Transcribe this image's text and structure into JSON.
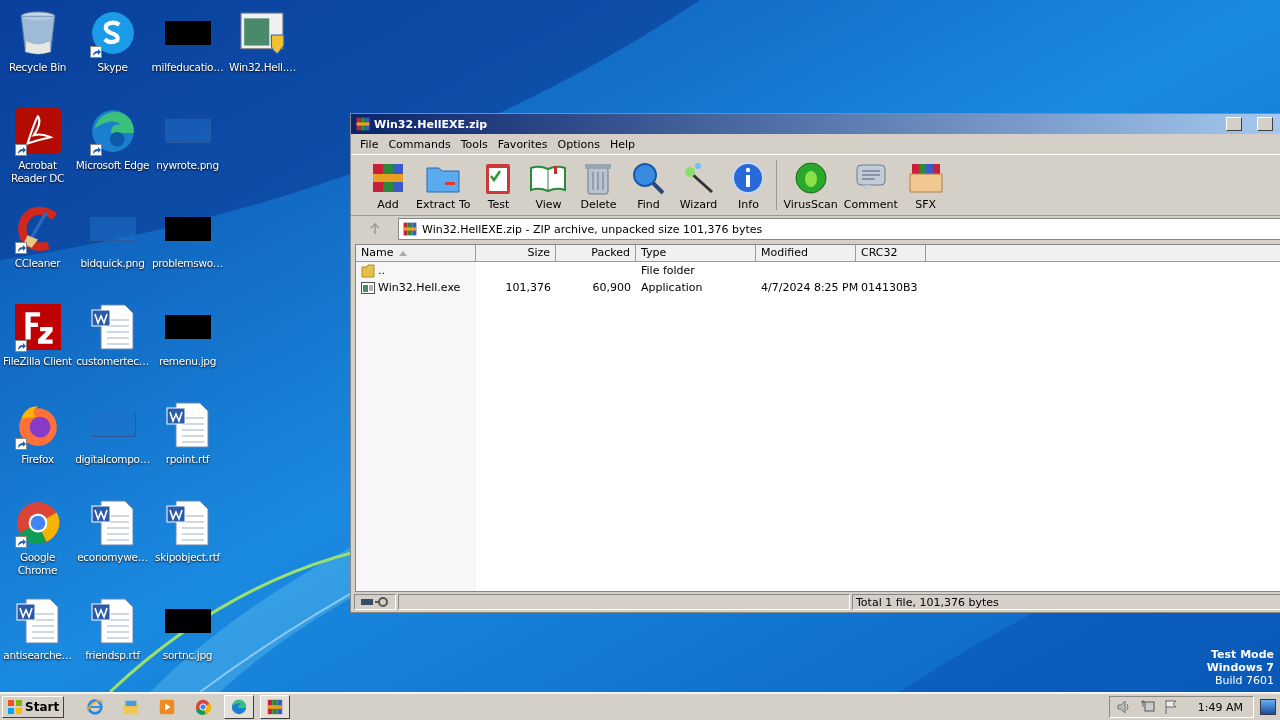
{
  "desktop": {
    "columns": [
      [
        {
          "label": "Recycle Bin",
          "kind": "recycle",
          "shortcut": false
        },
        {
          "label": "Acrobat Reader DC",
          "kind": "acrobat",
          "shortcut": true
        },
        {
          "label": "CCleaner",
          "kind": "ccleaner",
          "shortcut": true
        },
        {
          "label": "FileZilla Client",
          "kind": "filezilla",
          "shortcut": true
        },
        {
          "label": "Firefox",
          "kind": "firefox",
          "shortcut": true
        },
        {
          "label": "Google Chrome",
          "kind": "chrome",
          "shortcut": true
        },
        {
          "label": "antisearche…",
          "kind": "word",
          "shortcut": false
        }
      ],
      [
        {
          "label": "Skype",
          "kind": "skype",
          "shortcut": true
        },
        {
          "label": "Microsoft Edge",
          "kind": "edge",
          "shortcut": true
        },
        {
          "label": "bidquick.png",
          "kind": "blank",
          "shortcut": false
        },
        {
          "label": "customertec…",
          "kind": "word",
          "shortcut": false
        },
        {
          "label": "digitalcompo…",
          "kind": "blank",
          "shortcut": false
        },
        {
          "label": "economywe…",
          "kind": "word",
          "shortcut": false
        },
        {
          "label": "friendsp.rtf",
          "kind": "word",
          "shortcut": false
        }
      ],
      [
        {
          "label": "milfeducatio…",
          "kind": "black",
          "shortcut": false
        },
        {
          "label": "nywrote.png",
          "kind": "blank",
          "shortcut": false
        },
        {
          "label": "problemswo…",
          "kind": "black",
          "shortcut": false
        },
        {
          "label": "remenu.jpg",
          "kind": "black",
          "shortcut": false
        },
        {
          "label": "rpoint.rtf",
          "kind": "word",
          "shortcut": false
        },
        {
          "label": "skipobject.rtf",
          "kind": "word",
          "shortcut": false
        },
        {
          "label": "sortnc.jpg",
          "kind": "black",
          "shortcut": false
        }
      ],
      [
        {
          "label": "Win32.Hell.…",
          "kind": "exe",
          "shortcut": false
        }
      ]
    ],
    "watermark_lines": [
      "Test Mode",
      "Windows 7",
      "Build 7601"
    ]
  },
  "window": {
    "title": "Win32.HellEXE.zip",
    "menu": [
      "File",
      "Commands",
      "Tools",
      "Favorites",
      "Options",
      "Help"
    ],
    "toolbar": [
      {
        "label": "Add",
        "kind": "add"
      },
      {
        "label": "Extract To",
        "kind": "extract"
      },
      {
        "label": "Test",
        "kind": "test"
      },
      {
        "label": "View",
        "kind": "view"
      },
      {
        "label": "Delete",
        "kind": "delete"
      },
      {
        "label": "Find",
        "kind": "find"
      },
      {
        "label": "Wizard",
        "kind": "wizard"
      },
      {
        "label": "Info",
        "kind": "info"
      },
      {
        "label": "VirusScan",
        "kind": "virus"
      },
      {
        "label": "Comment",
        "kind": "comment"
      },
      {
        "label": "SFX",
        "kind": "sfx"
      }
    ],
    "address": "Win32.HellEXE.zip - ZIP archive, unpacked size 101,376 bytes",
    "columns": [
      "Name",
      "Size",
      "Packed",
      "Type",
      "Modified",
      "CRC32"
    ],
    "rows": [
      {
        "kind": "folder",
        "cells": [
          "..",
          "",
          "",
          "File folder",
          "",
          ""
        ]
      },
      {
        "kind": "exe",
        "cells": [
          "Win32.Hell.exe",
          "101,376",
          "60,900",
          "Application",
          "4/7/2024 8:25 PM",
          "014130B3"
        ]
      }
    ],
    "status": "Total 1 file, 101,376 bytes"
  },
  "taskbar": {
    "start": "Start",
    "apps": [
      {
        "kind": "ie",
        "active": false
      },
      {
        "kind": "explorer",
        "active": false
      },
      {
        "kind": "media",
        "active": false
      },
      {
        "kind": "chrome",
        "active": false
      },
      {
        "kind": "edge",
        "active": true
      },
      {
        "kind": "winrar",
        "active": true
      }
    ],
    "clock": "1:49 AM"
  }
}
